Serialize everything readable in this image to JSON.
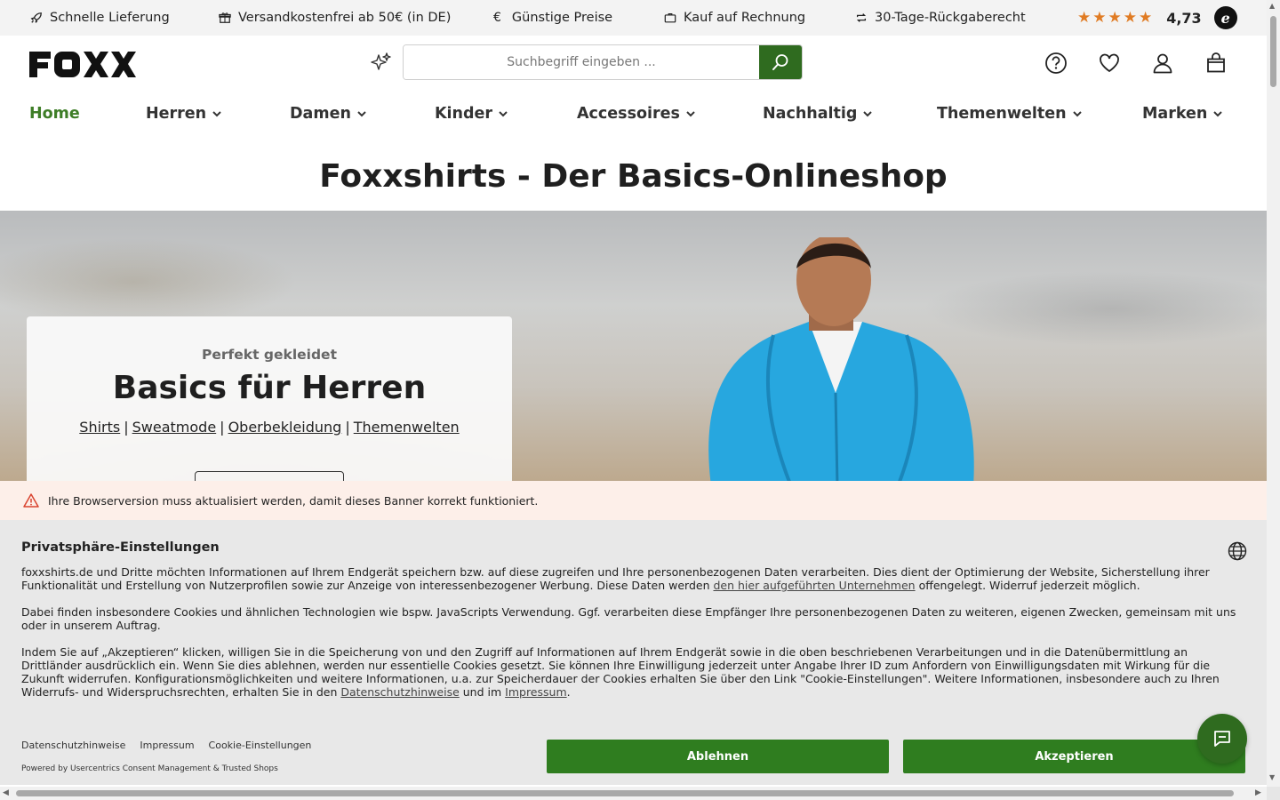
{
  "topbar": {
    "usps": [
      {
        "icon": "rocket-icon",
        "label": "Schnelle Lieferung"
      },
      {
        "icon": "gift-icon",
        "label": "Versandkostenfrei ab 50€ (in DE)"
      },
      {
        "icon": "euro-icon",
        "label": "Günstige Preise"
      },
      {
        "icon": "briefcase-icon",
        "label": "Kauf auf Rechnung"
      },
      {
        "icon": "return-icon",
        "label": "30-Tage-Rückgaberecht"
      }
    ],
    "rating": {
      "stars": "★★★★★",
      "score": "4,73",
      "badge": "e",
      "accent": "#e07b23"
    }
  },
  "header": {
    "logo": "FOXX",
    "search_placeholder": "Suchbegriff eingeben ...",
    "accent": "#2f6b1f"
  },
  "nav": {
    "items": [
      {
        "label": "Home",
        "active": true
      },
      {
        "label": "Herren"
      },
      {
        "label": "Damen"
      },
      {
        "label": "Kinder"
      },
      {
        "label": "Accessoires"
      },
      {
        "label": "Nachhaltig"
      },
      {
        "label": "Themenwelten"
      },
      {
        "label": "Marken"
      }
    ]
  },
  "page_title": "Foxxshirts - Der Basics-Onlineshop",
  "hero": {
    "kicker": "Perfekt gekleidet",
    "title": "Basics für Herren",
    "links": [
      "Shirts",
      "Sweatmode",
      "Oberbekleidung",
      "Themenwelten"
    ],
    "separator": "|"
  },
  "consent": {
    "warning": "Ihre Browserversion muss aktualisiert werden, damit dieses Banner korrekt funktioniert.",
    "title": "Privatsphäre-Einstellungen",
    "p1_a": "foxxshirts.de und Dritte möchten Informationen auf Ihrem Endgerät speichern bzw. auf diese zugreifen und Ihre personenbezogenen Daten verarbeiten. Dies dient der Optimierung der Website, Sicherstellung ihrer Funktionalität und Erstellung von Nutzerprofilen sowie zur Anzeige von interessenbezogener Werbung. Diese Daten werden ",
    "p1_link": "den hier aufgeführten Unternehmen",
    "p1_b": " offengelegt. Widerruf jederzeit möglich.",
    "p2": "Dabei finden insbesondere Cookies und ähnlichen Technologien wie bspw. JavaScripts Verwendung. Ggf. verarbeiten diese Empfänger Ihre personenbezogenen Daten zu weiteren, eigenen Zwecken, gemeinsam mit uns oder in unserem Auftrag.",
    "p3_a": "Indem Sie auf „Akzeptieren“ klicken, willigen Sie in die Speicherung von und den Zugriff auf Informationen auf Ihrem Endgerät sowie in die oben beschriebenen Verarbeitungen und in die Datenübermittlung an Drittländer ausdrücklich ein. Wenn Sie dies ablehnen, werden nur essentielle Cookies gesetzt. Sie können Ihre Einwilligung jederzeit unter Angabe Ihrer ID zum Anfordern von Einwilligungsdaten mit Wirkung für die Zukunft widerrufen. Konfigurationsmöglichkeiten und weitere Informationen, u.a. zur Speicherdauer der Cookies erhalten Sie über den Link \"Cookie-Einstellungen\". Weitere Informationen, insbesondere auch zu Ihren Widerrufs- und Widerspruchsrechten, erhalten Sie in den ",
    "p3_link1": "Datenschutzhinweise",
    "p3_mid": " und im ",
    "p3_link2": "Impressum",
    "p3_end": ".",
    "footer_links": [
      "Datenschutzhinweise",
      "Impressum",
      "Cookie-Einstellungen"
    ],
    "powered_by": "Powered by Usercentrics Consent Management & Trusted Shops",
    "decline": "Ablehnen",
    "accept": "Akzeptieren",
    "button_color": "#2f7d1f"
  }
}
